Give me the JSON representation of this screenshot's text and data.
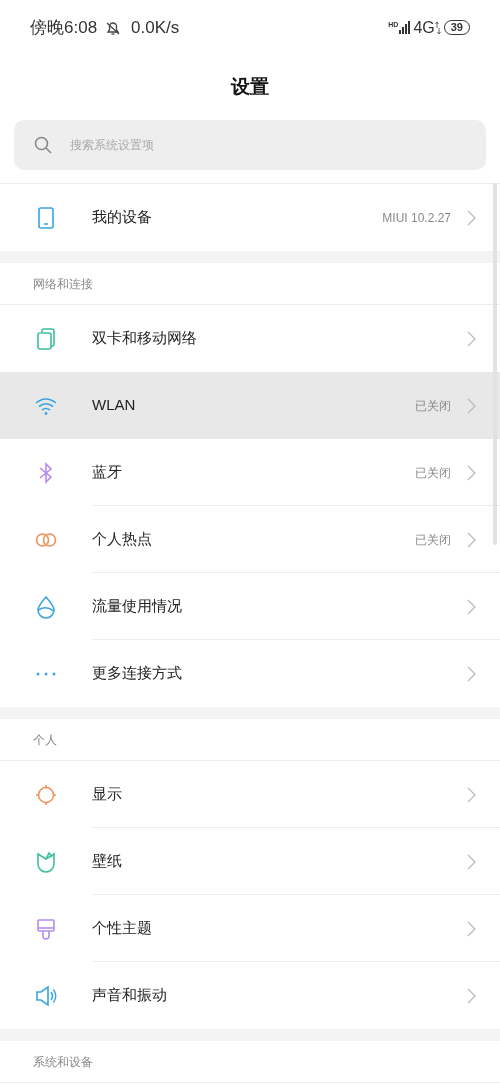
{
  "status_bar": {
    "time": "傍晚6:08",
    "speed": "0.0K/s",
    "hd": "HD",
    "network": "4G",
    "battery": "39"
  },
  "title": "设置",
  "search": {
    "placeholder": "搜索系统设置项"
  },
  "sections": [
    {
      "items": [
        {
          "label": "我的设备",
          "value": "MIUI 10.2.27",
          "selected": false
        }
      ]
    },
    {
      "header": "网络和连接",
      "items": [
        {
          "label": "双卡和移动网络",
          "selected": false
        },
        {
          "label": "WLAN",
          "value": "已关闭",
          "selected": true
        },
        {
          "label": "蓝牙",
          "value": "已关闭",
          "selected": false
        },
        {
          "label": "个人热点",
          "value": "已关闭",
          "selected": false
        },
        {
          "label": "流量使用情况",
          "selected": false
        },
        {
          "label": "更多连接方式",
          "selected": false
        }
      ]
    },
    {
      "header": "个人",
      "items": [
        {
          "label": "显示",
          "selected": false
        },
        {
          "label": "壁纸",
          "selected": false
        },
        {
          "label": "个性主题",
          "selected": false
        },
        {
          "label": "声音和振动",
          "selected": false
        }
      ]
    },
    {
      "header": "系统和设备"
    }
  ]
}
